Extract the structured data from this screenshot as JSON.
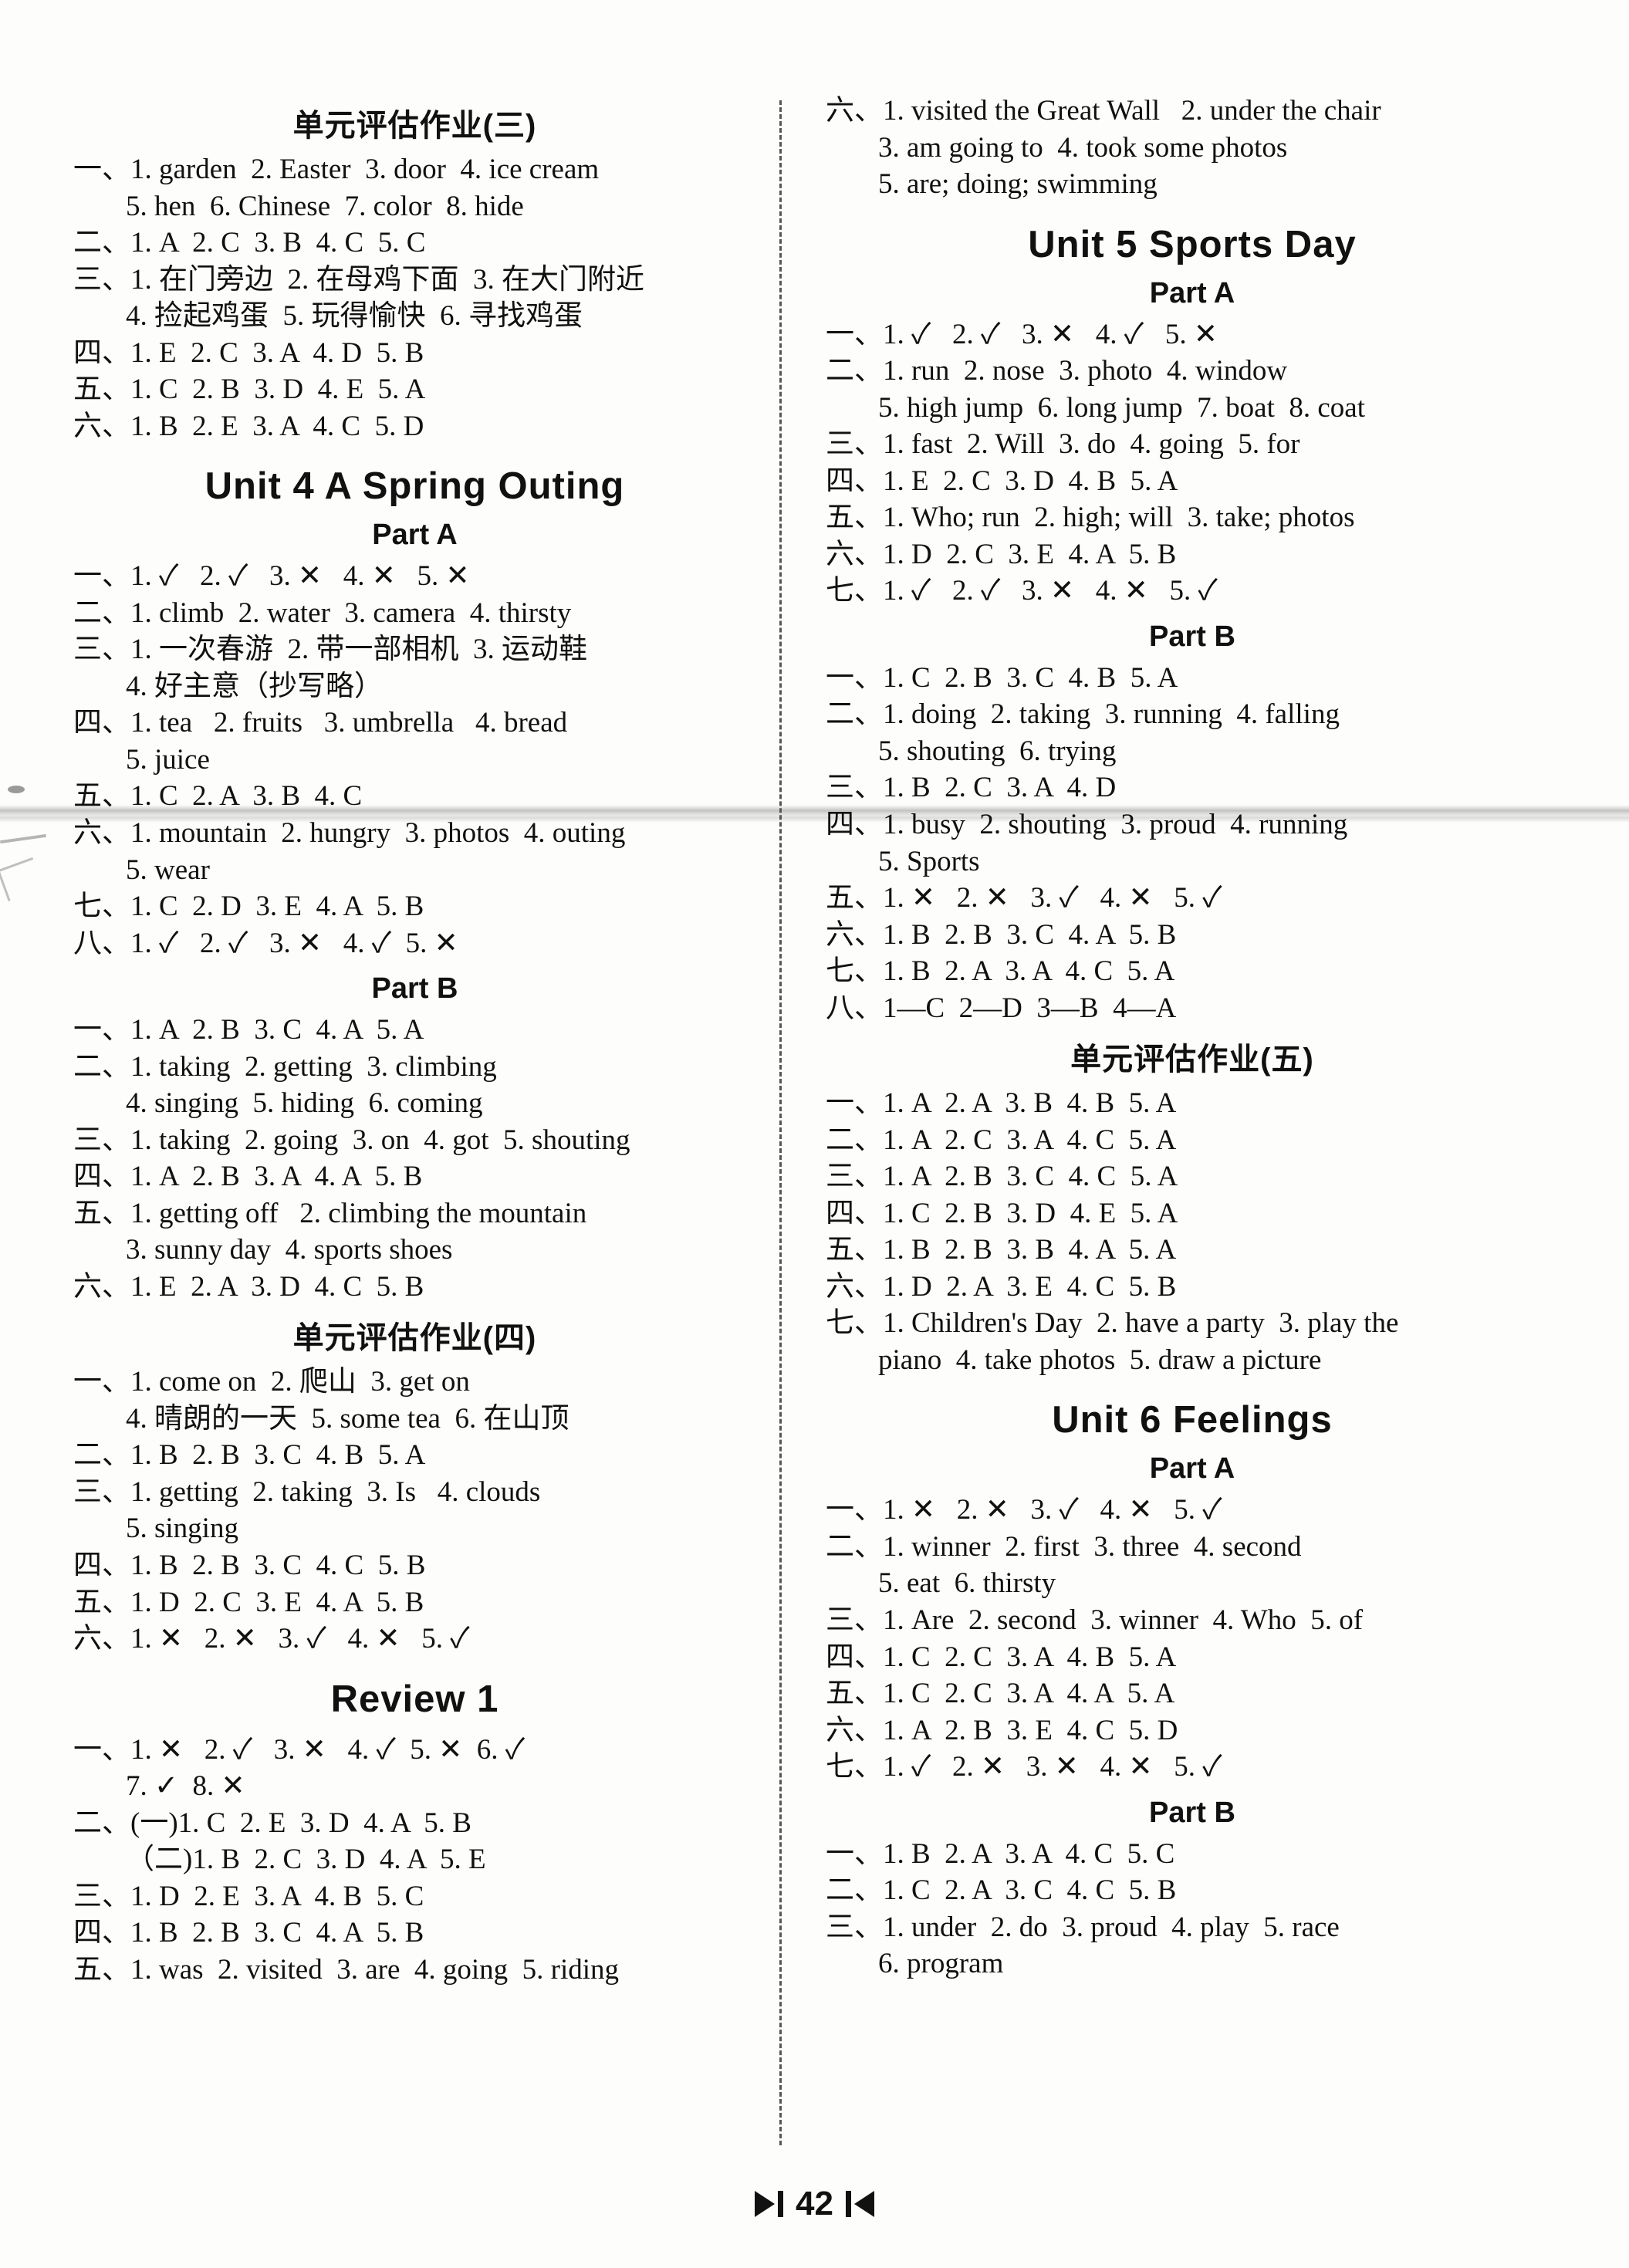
{
  "page": {
    "number": "42",
    "glyphs": {
      "tick": "✓",
      "cross": "✕"
    }
  },
  "left_column": {
    "blocks": [
      {
        "type": "heading",
        "style": "section",
        "name": "unit-assessment-3-heading",
        "text": "单元评估作业(三)"
      },
      {
        "type": "answer",
        "indent": false,
        "text": "一、1. garden  2. Easter  3. door  4. ice cream"
      },
      {
        "type": "answer",
        "indent": true,
        "text": "5. hen  6. Chinese  7. color  8. hide"
      },
      {
        "type": "answer",
        "indent": false,
        "text": "二、1. A  2. C  3. B  4. C  5. C"
      },
      {
        "type": "answer",
        "indent": false,
        "text": "三、1. 在门旁边  2. 在母鸡下面  3. 在大门附近"
      },
      {
        "type": "answer",
        "indent": true,
        "text": "4. 捡起鸡蛋  5. 玩得愉快  6. 寻找鸡蛋"
      },
      {
        "type": "answer",
        "indent": false,
        "text": "四、1. E  2. C  3. A  4. D  5. B"
      },
      {
        "type": "answer",
        "indent": false,
        "text": "五、1. C  2. B  3. D  4. E  5. A"
      },
      {
        "type": "answer",
        "indent": false,
        "text": "六、1. B  2. E  3. A  4. C  5. D"
      },
      {
        "type": "heading",
        "style": "unit",
        "name": "unit-4-heading",
        "text": "Unit 4   A Spring Outing"
      },
      {
        "type": "heading",
        "style": "part",
        "name": "unit-4-part-a-heading",
        "text": "Part A"
      },
      {
        "type": "answer",
        "indent": false,
        "text": "一、1. ✓   2. ✓   3. ✕   4. ✕   5. ✕"
      },
      {
        "type": "answer",
        "indent": false,
        "text": "二、1. climb  2. water  3. camera  4. thirsty"
      },
      {
        "type": "answer",
        "indent": false,
        "text": "三、1. 一次春游  2. 带一部相机  3. 运动鞋"
      },
      {
        "type": "answer",
        "indent": true,
        "text": "4. 好主意（抄写略）"
      },
      {
        "type": "answer",
        "indent": false,
        "text": "四、1. tea   2. fruits   3. umbrella   4. bread"
      },
      {
        "type": "answer",
        "indent": true,
        "text": "5. juice"
      },
      {
        "type": "answer",
        "indent": false,
        "text": "五、1. C  2. A  3. B  4. C"
      },
      {
        "type": "answer",
        "indent": false,
        "text": "六、1. mountain  2. hungry  3. photos  4. outing"
      },
      {
        "type": "answer",
        "indent": true,
        "text": "5. wear"
      },
      {
        "type": "answer",
        "indent": false,
        "text": "七、1. C  2. D  3. E  4. A  5. B"
      },
      {
        "type": "answer",
        "indent": false,
        "text": "八、1. ✓   2. ✓   3. ✕   4. ✓  5. ✕"
      },
      {
        "type": "heading",
        "style": "part",
        "name": "unit-4-part-b-heading",
        "text": "Part B"
      },
      {
        "type": "answer",
        "indent": false,
        "text": "一、1. A  2. B  3. C  4. A  5. A"
      },
      {
        "type": "answer",
        "indent": false,
        "text": "二、1. taking  2. getting  3. climbing"
      },
      {
        "type": "answer",
        "indent": true,
        "text": "4. singing  5. hiding  6. coming"
      },
      {
        "type": "answer",
        "indent": false,
        "text": "三、1. taking  2. going  3. on  4. got  5. shouting"
      },
      {
        "type": "answer",
        "indent": false,
        "text": "四、1. A  2. B  3. A  4. A  5. B"
      },
      {
        "type": "answer",
        "indent": false,
        "text": "五、1. getting off   2. climbing the mountain"
      },
      {
        "type": "answer",
        "indent": true,
        "text": "3. sunny day  4. sports shoes"
      },
      {
        "type": "answer",
        "indent": false,
        "text": "六、1. E  2. A  3. D  4. C  5. B"
      },
      {
        "type": "heading",
        "style": "section",
        "name": "unit-assessment-4-heading",
        "text": "单元评估作业(四)"
      },
      {
        "type": "answer",
        "indent": false,
        "text": "一、1. come on  2. 爬山  3. get on"
      },
      {
        "type": "answer",
        "indent": true,
        "text": "4. 晴朗的一天  5. some tea  6. 在山顶"
      },
      {
        "type": "answer",
        "indent": false,
        "text": "二、1. B  2. B  3. C  4. B  5. A"
      },
      {
        "type": "answer",
        "indent": false,
        "text": "三、1. getting  2. taking  3. Is   4. clouds"
      },
      {
        "type": "answer",
        "indent": true,
        "text": "5. singing"
      },
      {
        "type": "answer",
        "indent": false,
        "text": "四、1. B  2. B  3. C  4. C  5. B"
      },
      {
        "type": "answer",
        "indent": false,
        "text": "五、1. D  2. C  3. E  4. A  5. B"
      },
      {
        "type": "answer",
        "indent": false,
        "text": "六、1. ✕   2. ✕   3. ✓   4. ✕   5. ✓"
      },
      {
        "type": "heading",
        "style": "unit",
        "name": "review-1-heading",
        "text": "Review 1"
      },
      {
        "type": "answer",
        "indent": false,
        "text": "一、1. ✕   2. ✓   3. ✕   4. ✓  5. ✕  6. ✓"
      },
      {
        "type": "answer",
        "indent": true,
        "text": "7. ✓  8. ✕"
      },
      {
        "type": "answer",
        "indent": false,
        "text": "二、(一)1. C  2. E  3. D  4. A  5. B"
      },
      {
        "type": "answer",
        "indent": true,
        "text": "（二)1. B  2. C  3. D  4. A  5. E"
      },
      {
        "type": "answer",
        "indent": false,
        "text": "三、1. D  2. E  3. A  4. B  5. C"
      },
      {
        "type": "answer",
        "indent": false,
        "text": "四、1. B  2. B  3. C  4. A  5. B"
      },
      {
        "type": "answer",
        "indent": false,
        "text": "五、1. was  2. visited  3. are  4. going  5. riding"
      }
    ]
  },
  "right_column": {
    "blocks": [
      {
        "type": "answer",
        "indent": false,
        "text": "六、1. visited the Great Wall   2. under the chair"
      },
      {
        "type": "answer",
        "indent": true,
        "text": "3. am going to  4. took some photos"
      },
      {
        "type": "answer",
        "indent": true,
        "text": "5. are; doing; swimming"
      },
      {
        "type": "heading",
        "style": "unit",
        "name": "unit-5-heading",
        "text": "Unit 5   Sports Day"
      },
      {
        "type": "heading",
        "style": "part",
        "name": "unit-5-part-a-heading",
        "text": "Part A"
      },
      {
        "type": "answer",
        "indent": false,
        "text": "一、1. ✓   2. ✓   3. ✕   4. ✓   5. ✕"
      },
      {
        "type": "answer",
        "indent": false,
        "text": "二、1. run  2. nose  3. photo  4. window"
      },
      {
        "type": "answer",
        "indent": true,
        "text": "5. high jump  6. long jump  7. boat  8. coat"
      },
      {
        "type": "answer",
        "indent": false,
        "text": "三、1. fast  2. Will  3. do  4. going  5. for"
      },
      {
        "type": "answer",
        "indent": false,
        "text": "四、1. E  2. C  3. D  4. B  5. A"
      },
      {
        "type": "answer",
        "indent": false,
        "text": "五、1. Who; run  2. high; will  3. take; photos"
      },
      {
        "type": "answer",
        "indent": false,
        "text": "六、1. D  2. C  3. E  4. A  5. B"
      },
      {
        "type": "answer",
        "indent": false,
        "text": "七、1. ✓   2. ✓   3. ✕   4. ✕   5. ✓"
      },
      {
        "type": "heading",
        "style": "part",
        "name": "unit-5-part-b-heading",
        "text": "Part B"
      },
      {
        "type": "answer",
        "indent": false,
        "text": "一、1. C  2. B  3. C  4. B  5. A"
      },
      {
        "type": "answer",
        "indent": false,
        "text": "二、1. doing  2. taking  3. running  4. falling"
      },
      {
        "type": "answer",
        "indent": true,
        "text": "5. shouting  6. trying"
      },
      {
        "type": "answer",
        "indent": false,
        "text": "三、1. B  2. C  3. A  4. D"
      },
      {
        "type": "answer",
        "indent": false,
        "text": "四、1. busy  2. shouting  3. proud  4. running"
      },
      {
        "type": "answer",
        "indent": true,
        "text": "5. Sports"
      },
      {
        "type": "answer",
        "indent": false,
        "text": "五、1. ✕   2. ✕   3. ✓   4. ✕   5. ✓"
      },
      {
        "type": "answer",
        "indent": false,
        "text": "六、1. B  2. B  3. C  4. A  5. B"
      },
      {
        "type": "answer",
        "indent": false,
        "text": "七、1. B  2. A  3. A  4. C  5. A"
      },
      {
        "type": "answer",
        "indent": false,
        "text": "八、1—C  2—D  3—B  4—A"
      },
      {
        "type": "heading",
        "style": "section",
        "name": "unit-assessment-5-heading",
        "text": "单元评估作业(五)"
      },
      {
        "type": "answer",
        "indent": false,
        "text": "一、1. A  2. A  3. B  4. B  5. A"
      },
      {
        "type": "answer",
        "indent": false,
        "text": "二、1. A  2. C  3. A  4. C  5. A"
      },
      {
        "type": "answer",
        "indent": false,
        "text": "三、1. A  2. B  3. C  4. C  5. A"
      },
      {
        "type": "answer",
        "indent": false,
        "text": "四、1. C  2. B  3. D  4. E  5. A"
      },
      {
        "type": "answer",
        "indent": false,
        "text": "五、1. B  2. B  3. B  4. A  5. A"
      },
      {
        "type": "answer",
        "indent": false,
        "text": "六、1. D  2. A  3. E  4. C  5. B"
      },
      {
        "type": "answer",
        "indent": false,
        "text": "七、1. Children's Day  2. have a party  3. play the"
      },
      {
        "type": "answer",
        "indent": true,
        "text": "piano  4. take photos  5. draw a picture"
      },
      {
        "type": "heading",
        "style": "unit",
        "name": "unit-6-heading",
        "text": "Unit 6   Feelings"
      },
      {
        "type": "heading",
        "style": "part",
        "name": "unit-6-part-a-heading",
        "text": "Part A"
      },
      {
        "type": "answer",
        "indent": false,
        "text": "一、1. ✕   2. ✕   3. ✓   4. ✕   5. ✓"
      },
      {
        "type": "answer",
        "indent": false,
        "text": "二、1. winner  2. first  3. three  4. second"
      },
      {
        "type": "answer",
        "indent": true,
        "text": "5. eat  6. thirsty"
      },
      {
        "type": "answer",
        "indent": false,
        "text": "三、1. Are  2. second  3. winner  4. Who  5. of"
      },
      {
        "type": "answer",
        "indent": false,
        "text": "四、1. C  2. C  3. A  4. B  5. A"
      },
      {
        "type": "answer",
        "indent": false,
        "text": "五、1. C  2. C  3. A  4. A  5. A"
      },
      {
        "type": "answer",
        "indent": false,
        "text": "六、1. A  2. B  3. E  4. C  5. D"
      },
      {
        "type": "answer",
        "indent": false,
        "text": "七、1. ✓   2. ✕   3. ✕   4. ✕   5. ✓"
      },
      {
        "type": "heading",
        "style": "part",
        "name": "unit-6-part-b-heading",
        "text": "Part B"
      },
      {
        "type": "answer",
        "indent": false,
        "text": "一、1. B  2. A  3. A  4. C  5. C"
      },
      {
        "type": "answer",
        "indent": false,
        "text": "二、1. C  2. A  3. C  4. C  5. B"
      },
      {
        "type": "answer",
        "indent": false,
        "text": "三、1. under  2. do  3. proud  4. play  5. race"
      },
      {
        "type": "answer",
        "indent": true,
        "text": "6. program"
      }
    ]
  }
}
